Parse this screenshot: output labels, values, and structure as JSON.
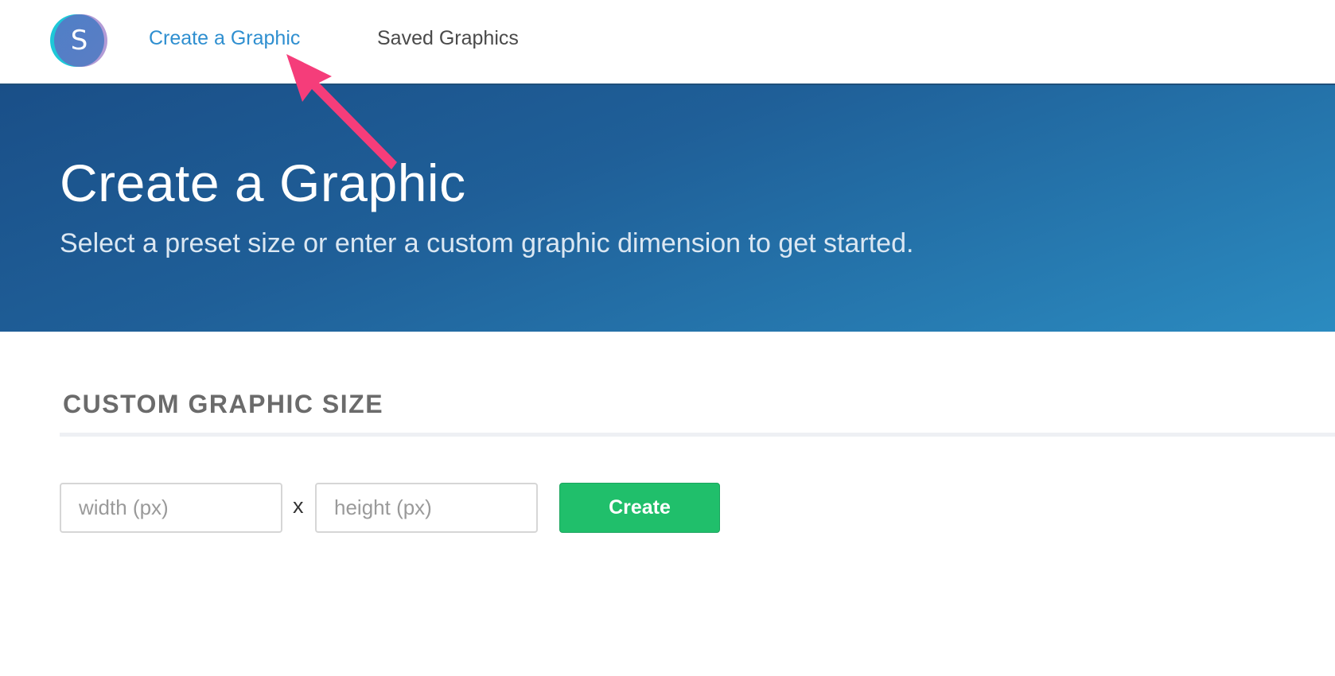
{
  "app": {
    "logo_letter": "S",
    "colors": {
      "accent": "#2f8fd0",
      "hero_start": "#1a4f88",
      "hero_end": "#2b8bc0",
      "create_button": "#20bf6b",
      "annotation_arrow": "#f53d7a"
    }
  },
  "nav": {
    "items": [
      {
        "label": "Create a Graphic",
        "active": true
      },
      {
        "label": "Saved Graphics",
        "active": false
      }
    ]
  },
  "hero": {
    "title": "Create a Graphic",
    "subtitle": "Select a preset size or enter a custom graphic dimension to get started."
  },
  "custom_size": {
    "heading": "CUSTOM GRAPHIC SIZE",
    "width_placeholder": "width (px)",
    "height_placeholder": "height (px)",
    "separator": "x",
    "create_label": "Create"
  },
  "annotation": {
    "icon": "arrow-icon",
    "target": "Create a Graphic"
  }
}
